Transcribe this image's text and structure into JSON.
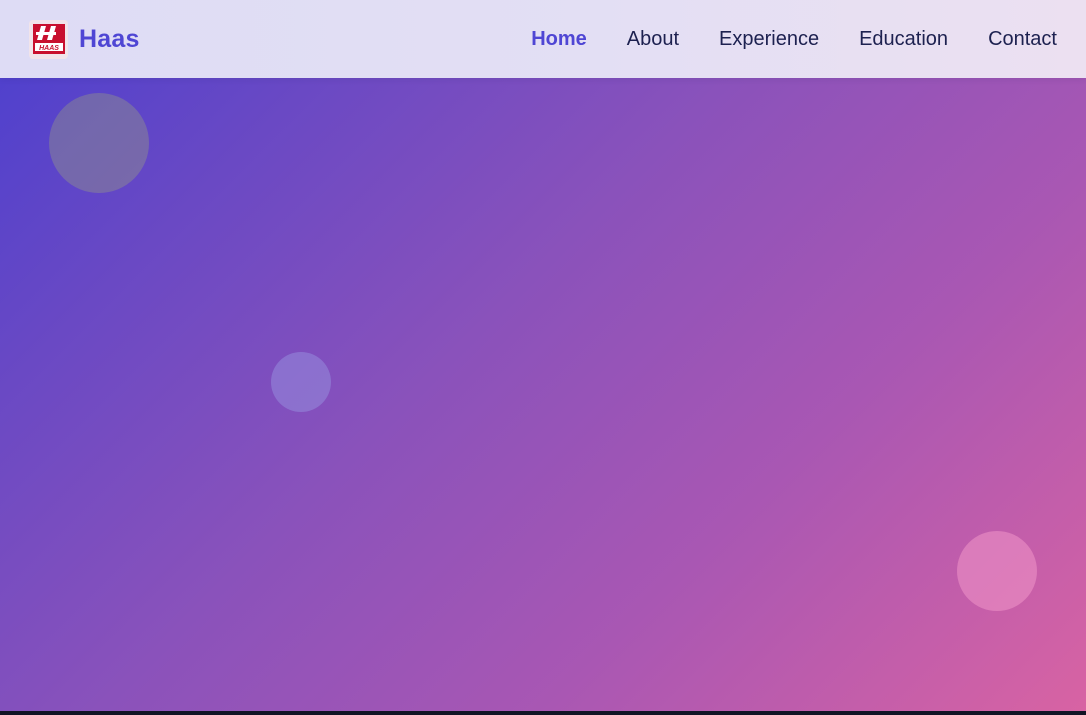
{
  "brand": {
    "name": "Haas",
    "logo_icon": "haas-logo-icon",
    "color": "#4f46d4"
  },
  "nav": {
    "items": [
      {
        "label": "Home",
        "active": true
      },
      {
        "label": "About",
        "active": false
      },
      {
        "label": "Experience",
        "active": false
      },
      {
        "label": "Education",
        "active": false
      },
      {
        "label": "Contact",
        "active": false
      }
    ]
  },
  "colors": {
    "accent": "#4f46d4",
    "nav_text": "#1d2150",
    "gradient_start": "#4a3fcf",
    "gradient_end": "#d863a3"
  }
}
